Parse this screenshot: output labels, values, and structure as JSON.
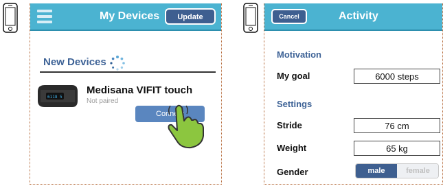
{
  "left_screen": {
    "title": "My Devices",
    "update_button": "Update",
    "section_title": "New Devices",
    "device": {
      "name": "Medisana VIFIT touch",
      "status": "Not paired",
      "band_display": "6118 5",
      "connect_button": "Connect"
    },
    "icons": [
      "phone-icon",
      "menu-icon",
      "spinner-icon",
      "fitness-band-icon",
      "tap-hand-icon"
    ]
  },
  "right_screen": {
    "title": "Activity",
    "cancel_button": "Cancel",
    "motivation": {
      "section_title": "Motivation",
      "goal_label": "My goal",
      "goal_value": "6000 steps"
    },
    "settings": {
      "section_title": "Settings",
      "stride_label": "Stride",
      "stride_value": "76 cm",
      "weight_label": "Weight",
      "weight_value": "65 kg",
      "gender_label": "Gender",
      "gender_options": [
        "male",
        "female"
      ],
      "gender_selected": "male"
    }
  },
  "colors": {
    "topbar": "#4bb3d1",
    "button_dark": "#3e5f90",
    "button_connect": "#5a86bf",
    "section_blue": "#3d6296",
    "hand_green": "#8cc63f"
  }
}
